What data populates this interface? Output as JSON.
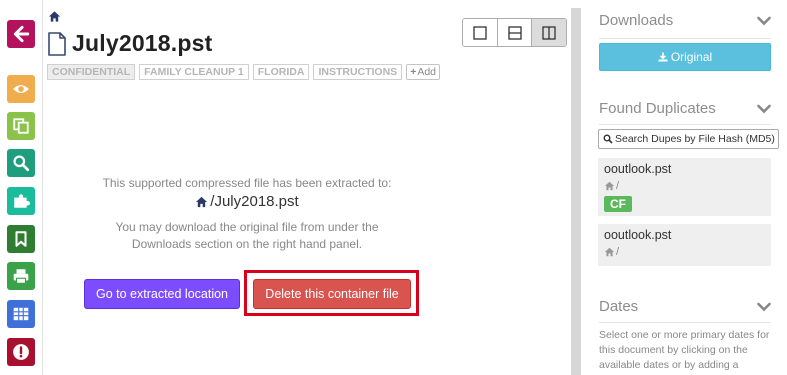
{
  "left_rail": {
    "buttons": [
      {
        "icon": "arrow-left-icon",
        "color": "#b3125c"
      },
      {
        "icon": "eye-icon",
        "color": "#f0ad4e"
      },
      {
        "icon": "copy-icon",
        "color": "#8bc34a"
      },
      {
        "icon": "search-icon",
        "color": "#1e9e7e"
      },
      {
        "icon": "puzzle-icon",
        "color": "#1abc9c"
      },
      {
        "icon": "bookmark-icon",
        "color": "#2e7d32"
      },
      {
        "icon": "print-icon",
        "color": "#3aa34a"
      },
      {
        "icon": "table-icon",
        "color": "#3f6fd8"
      },
      {
        "icon": "exclamation-icon",
        "color": "#a8102f"
      }
    ]
  },
  "document": {
    "title": "July2018.pst",
    "tags": [
      "CONFIDENTIAL",
      "FAMILY CLEANUP 1",
      "FLORIDA",
      "INSTRUCTIONS"
    ],
    "add_tag_label": "Add"
  },
  "message": {
    "line1": "This supported compressed file has been extracted to:",
    "path": "/July2018.pst",
    "line2": "You may download the original file from under the",
    "line3": "Downloads section on the right hand panel."
  },
  "actions": {
    "goto_label": "Go to extracted location",
    "delete_label": "Delete this container file"
  },
  "right_panel": {
    "downloads": {
      "heading": "Downloads",
      "original_label": "Original"
    },
    "duplicates": {
      "heading": "Found Duplicates",
      "search_label": "Search Dupes by File Hash (MD5)",
      "items": [
        {
          "name": "ooutlook.pst",
          "path": "/",
          "badge": "CF"
        },
        {
          "name": "ooutlook.pst",
          "path": "/"
        }
      ]
    },
    "dates": {
      "heading": "Dates",
      "description": "Select one or more primary dates for this document by clicking on the available dates or by adding a"
    }
  },
  "colors": {
    "goto_button": "#7c4dff",
    "delete_button": "#d9534f",
    "highlight_border": "#d9001b",
    "original_button": "#5bc0de",
    "cf_badge": "#5cb85c"
  }
}
